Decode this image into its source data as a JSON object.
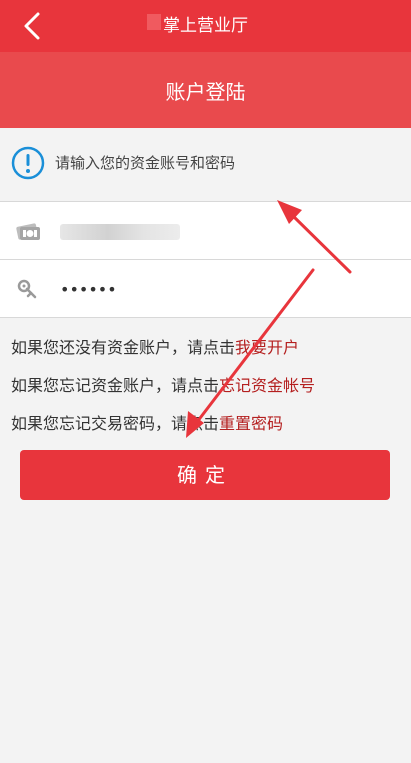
{
  "header": {
    "title": "掌上营业厅",
    "back_icon": "chevron-left-icon"
  },
  "subheader": {
    "title": "账户登陆"
  },
  "notice": {
    "icon": "exclamation-circle-icon",
    "text": "请输入您的资金账号和密码"
  },
  "form": {
    "account_icon": "money-icon",
    "account_value": "",
    "password_icon": "key-icon",
    "password_value": "••••••"
  },
  "links": [
    {
      "prefix": "如果您还没有资金账户，请点击",
      "action": "我要开户"
    },
    {
      "prefix": "如果您忘记资金账户，请点击",
      "action": "忘记资金帐号"
    },
    {
      "prefix": "如果您忘记交易密码，请点击",
      "action": "重置密码"
    }
  ],
  "confirm_label": "确定",
  "colors": {
    "brand": "#e8353c",
    "link_action": "#b41f1f",
    "info_icon": "#1a8fd8"
  }
}
